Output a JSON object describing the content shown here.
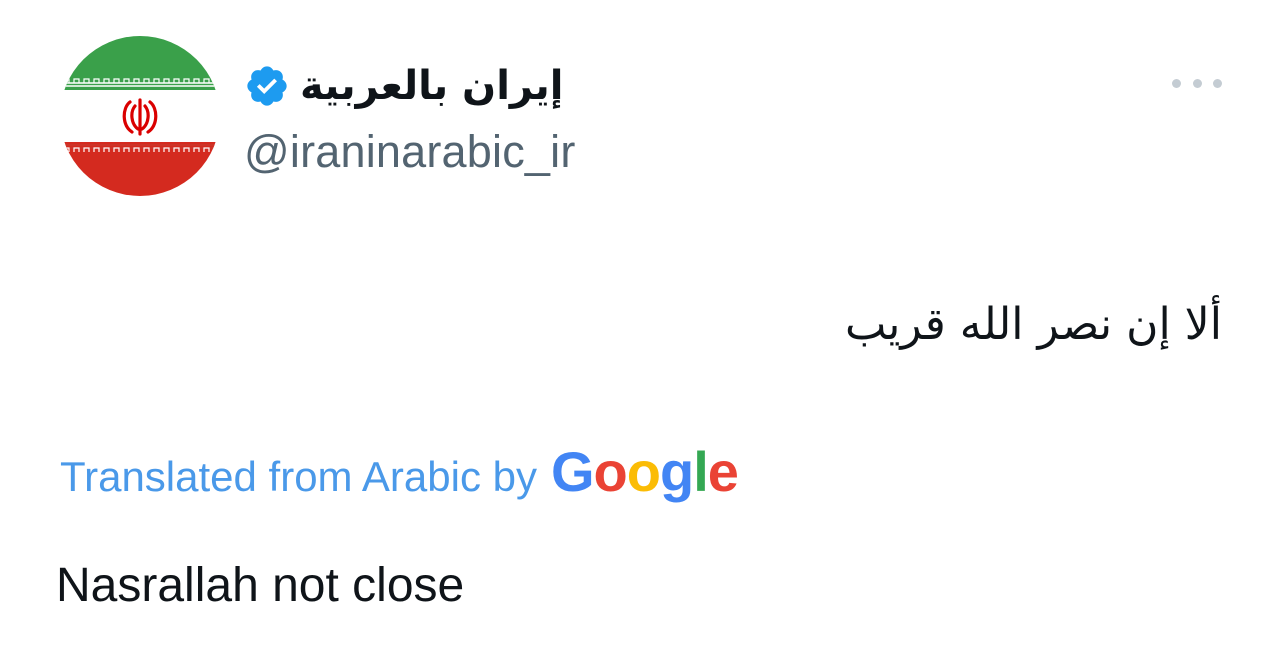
{
  "account": {
    "display_name": "إيران بالعربية",
    "handle": "@iraninarabic_ir",
    "verified": true,
    "avatar_icon": "iran-flag-icon"
  },
  "menu": {
    "more_icon": "more-dots-icon"
  },
  "tweet": {
    "text": "ألا إن نصر الله قريب",
    "translation_label": "Translated from Arabic by",
    "translation_provider_letters": [
      {
        "char": "G",
        "color": "#4285F4"
      },
      {
        "char": "o",
        "color": "#EA4335"
      },
      {
        "char": "o",
        "color": "#FBBC05"
      },
      {
        "char": "g",
        "color": "#4285F4"
      },
      {
        "char": "l",
        "color": "#34A853"
      },
      {
        "char": "e",
        "color": "#EA4335"
      }
    ],
    "translated_text": "Nasrallah not close"
  },
  "colors": {
    "verified_blue": "#1d9bf0",
    "link_blue": "#4a99e9",
    "handle_gray": "#536471",
    "flag_green": "#239f40",
    "flag_red": "#da0000"
  }
}
